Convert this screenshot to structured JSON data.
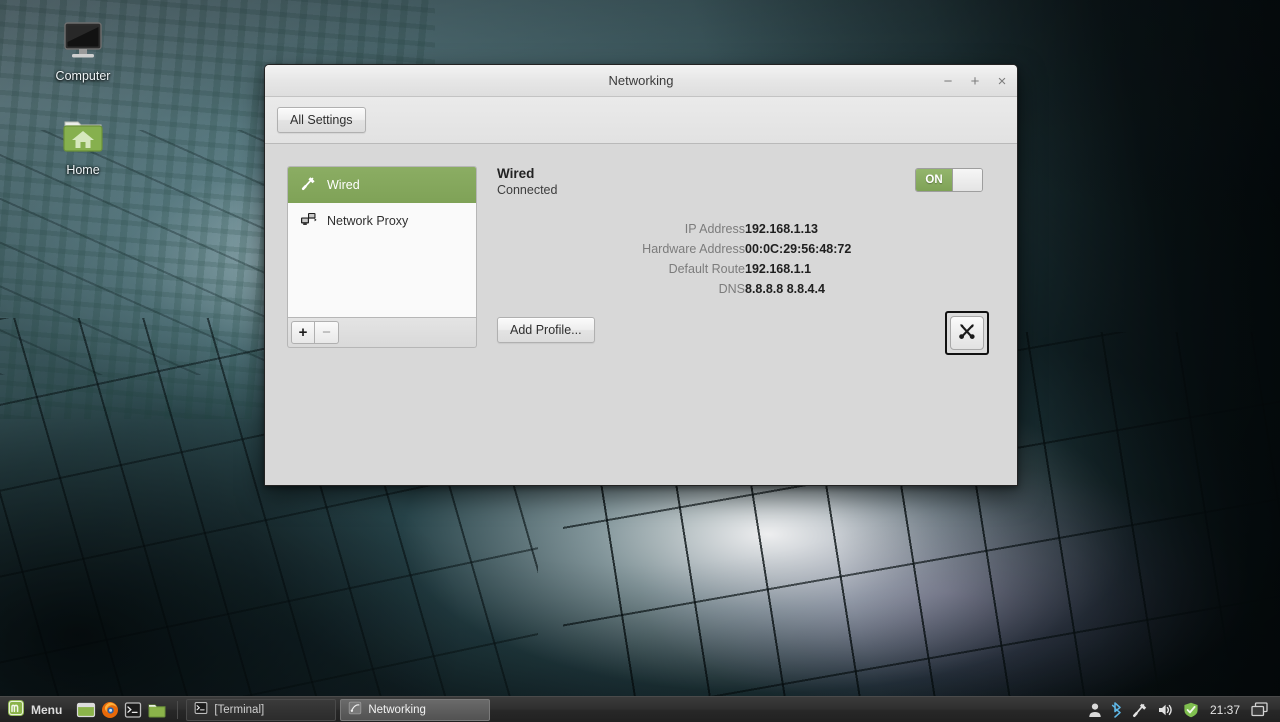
{
  "desktop": {
    "icons": [
      {
        "name": "computer",
        "label": "Computer",
        "icon": "monitor-icon"
      },
      {
        "name": "home",
        "label": "Home",
        "icon": "home-folder-icon"
      }
    ]
  },
  "window": {
    "title": "Networking",
    "controls": {
      "minimize": "−",
      "maximize": "+",
      "close": "×"
    },
    "toolbar": {
      "all_settings_label": "All Settings"
    },
    "sidebar": {
      "items": [
        {
          "label": "Wired",
          "icon": "wired-network-icon",
          "selected": true
        },
        {
          "label": "Network Proxy",
          "icon": "proxy-monitors-icon",
          "selected": false
        }
      ],
      "add_label": "+",
      "remove_label": "−"
    },
    "detail": {
      "device_name": "Wired",
      "device_status": "Connected",
      "toggle": {
        "state_label": "ON",
        "on": true
      },
      "fields": [
        {
          "label": "IP Address",
          "value": "192.168.1.13"
        },
        {
          "label": "Hardware Address",
          "value": "00:0C:29:56:48:72"
        },
        {
          "label": "Default Route",
          "value": "192.168.1.1"
        },
        {
          "label": "DNS",
          "value": "8.8.8.8 8.8.4.4"
        }
      ],
      "add_profile_label": "Add Profile...",
      "options_icon": "tools-icon"
    }
  },
  "taskbar": {
    "menu_label": "Menu",
    "menu_icon": "linux-mint-logo-icon",
    "launchers": [
      {
        "name": "show-desktop",
        "icon": "show-desktop-icon"
      },
      {
        "name": "firefox",
        "icon": "firefox-icon"
      },
      {
        "name": "terminal",
        "icon": "terminal-icon"
      },
      {
        "name": "files",
        "icon": "folder-icon"
      }
    ],
    "windows": [
      {
        "label": "[Terminal]",
        "icon": "terminal-icon",
        "active": false
      },
      {
        "label": "Networking",
        "icon": "networking-icon",
        "active": true
      }
    ],
    "tray": [
      {
        "name": "user",
        "icon": "user-icon"
      },
      {
        "name": "bluetooth",
        "icon": "bluetooth-icon"
      },
      {
        "name": "network",
        "icon": "network-icon"
      },
      {
        "name": "volume",
        "icon": "volume-icon"
      },
      {
        "name": "updates",
        "icon": "shield-check-icon"
      }
    ],
    "clock": "21:37",
    "workspace_icon": "workspace-switcher-icon"
  },
  "colors": {
    "accent_green": "#7fa257",
    "window_bg": "#d8d8d8",
    "panel_bg": "#2f2f2f"
  }
}
